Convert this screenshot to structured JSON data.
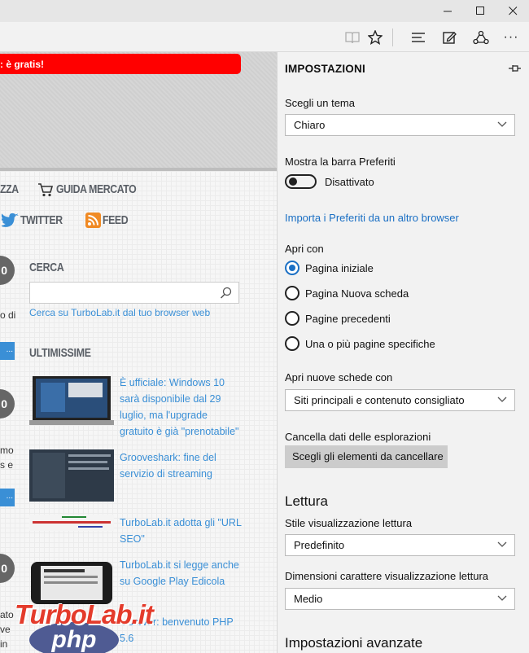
{
  "window": {
    "min": "—",
    "max": "☐",
    "close": "✕"
  },
  "toolbar": {
    "reading_view": "reading-view-icon",
    "favorite": "star-icon",
    "hub": "hub-icon",
    "note": "web-note-icon",
    "share": "share-icon",
    "more": "···"
  },
  "webpage": {
    "banner_text": ": è gratis!",
    "nav": {
      "first_fragment": "ZZA",
      "market": "GUIDA MERCATO",
      "twitter": "TWITTER",
      "feed": "FEED"
    },
    "left_fragments": [
      "o di",
      "mo",
      "s e",
      "ato",
      "ve",
      "in"
    ],
    "circle_digits": [
      "0",
      "0",
      "0"
    ],
    "more_buttons": [
      "...",
      "..."
    ],
    "search": {
      "heading": "CERCA",
      "hint": "Cerca su TurboLab.it dal tuo browser web"
    },
    "latest": {
      "heading": "ULTIMISSIME",
      "items": [
        {
          "text": "È ufficiale: Windows 10 sarà disponibile dal 29 luglio, ma l'upgrade gratuito è già \"prenotabile\""
        },
        {
          "text": "Grooveshark: fine del servizio di streaming"
        },
        {
          "text": "TurboLab.it adotta gli \"URL SEO\""
        },
        {
          "text": "TurboLab.it si legge anche su Google Play Edicola"
        },
        {
          "text": "...server: benvenuto PHP 5.6"
        }
      ]
    },
    "watermark": "TurboLab.it",
    "php_logo": "php"
  },
  "settings": {
    "title": "IMPOSTAZIONI",
    "theme": {
      "label": "Scegli un tema",
      "value": "Chiaro"
    },
    "favbar": {
      "label": "Mostra la barra Preferiti",
      "state": "Disattivato"
    },
    "import_link": "Importa i Preferiti da un altro browser",
    "open_with": {
      "label": "Apri con",
      "options": [
        "Pagina iniziale",
        "Pagina Nuova scheda",
        "Pagine precedenti",
        "Una o più pagine specifiche"
      ],
      "selected": 0
    },
    "new_tabs": {
      "label": "Apri nuove schede con",
      "value": "Siti principali e contenuto consigliato"
    },
    "clear": {
      "label": "Cancella dati delle esplorazioni",
      "button": "Scegli gli elementi da cancellare"
    },
    "reading": {
      "heading": "Lettura",
      "style_label": "Stile visualizzazione lettura",
      "style_value": "Predefinito",
      "size_label": "Dimensioni carattere visualizzazione lettura",
      "size_value": "Medio"
    },
    "advanced": "Impostazioni avanzate"
  }
}
